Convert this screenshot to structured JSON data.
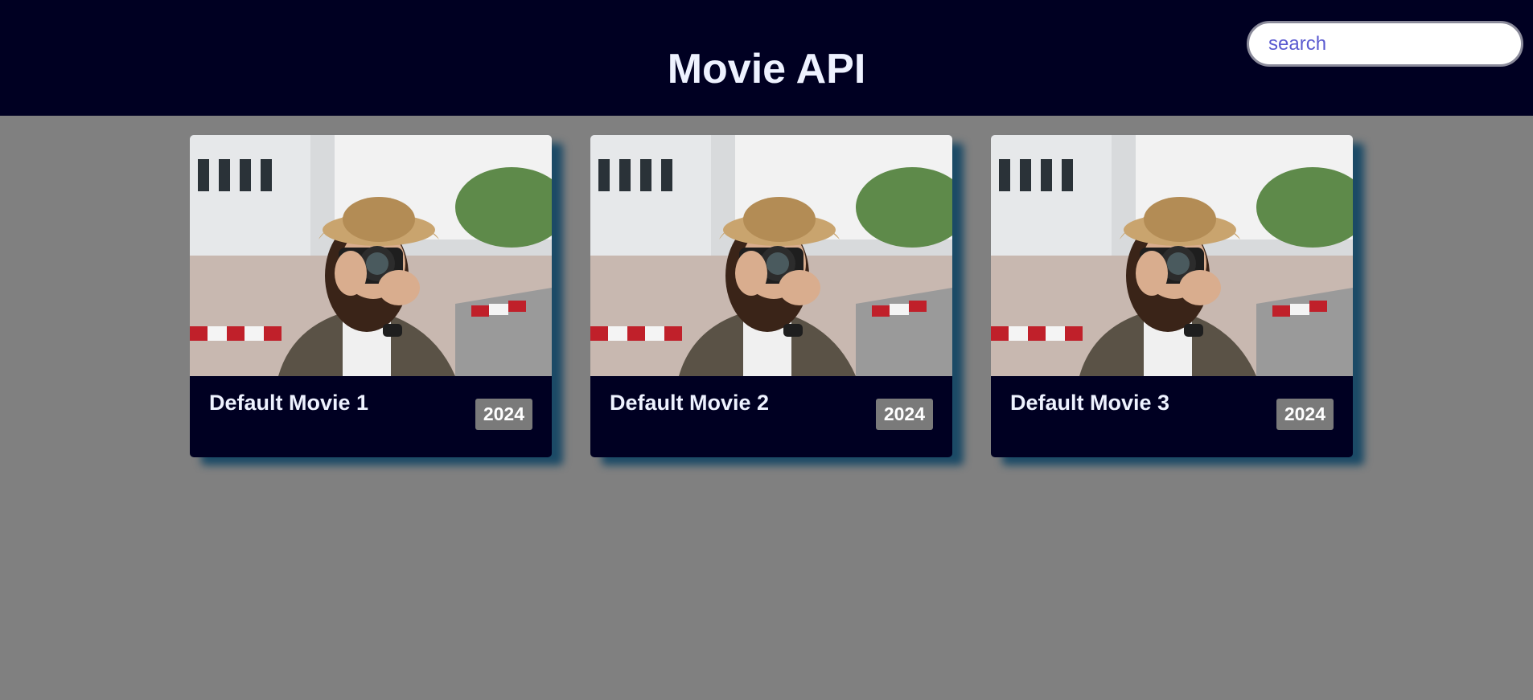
{
  "header": {
    "title": "Movie API",
    "search_placeholder": "search",
    "search_value": ""
  },
  "movies": [
    {
      "title": "Default Movie 1",
      "year": "2024",
      "poster_icon": "photographer-with-camera-image"
    },
    {
      "title": "Default Movie 2",
      "year": "2024",
      "poster_icon": "photographer-with-camera-image"
    },
    {
      "title": "Default Movie 3",
      "year": "2024",
      "poster_icon": "photographer-with-camera-image"
    }
  ],
  "colors": {
    "header_bg": "#000022",
    "page_bg": "#808080",
    "card_bg": "#000022",
    "badge_bg": "#7a7a7a",
    "shadow": "#1b4a66"
  }
}
